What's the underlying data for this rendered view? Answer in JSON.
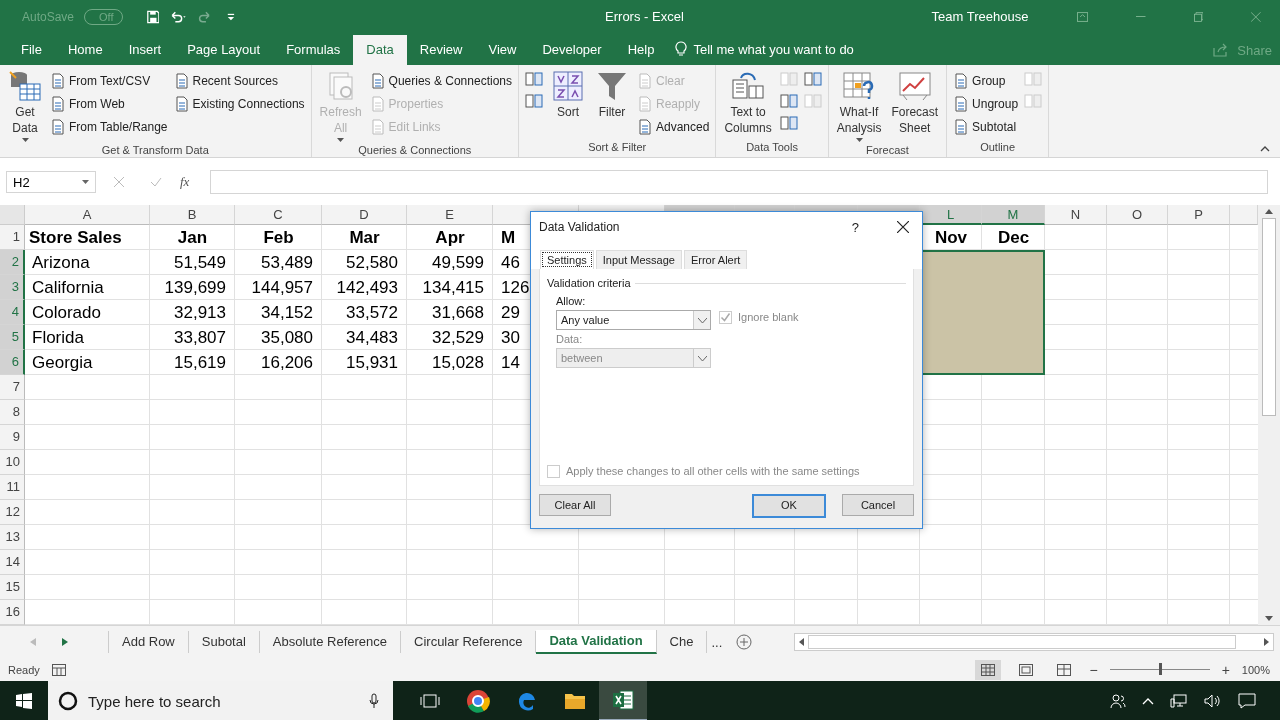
{
  "titlebar": {
    "autosave": "AutoSave",
    "autosave_state": "Off",
    "title": "Errors  -  Excel",
    "user": "Team Treehouse"
  },
  "menu_tabs": [
    {
      "label": "File",
      "selected": false
    },
    {
      "label": "Home",
      "selected": false
    },
    {
      "label": "Insert",
      "selected": false
    },
    {
      "label": "Page Layout",
      "selected": false
    },
    {
      "label": "Formulas",
      "selected": false
    },
    {
      "label": "Data",
      "selected": true
    },
    {
      "label": "Review",
      "selected": false
    },
    {
      "label": "View",
      "selected": false
    },
    {
      "label": "Developer",
      "selected": false
    },
    {
      "label": "Help",
      "selected": false
    }
  ],
  "tell_me": "Tell me what you want to do",
  "share": "Share",
  "ribbon": [
    {
      "label": "Get & Transform Data",
      "columns": [
        {
          "kind": "large",
          "lines": [
            "Get",
            "Data"
          ],
          "caret": true,
          "disabled": false
        },
        {
          "kind": "small",
          "items": [
            {
              "label": "From Text/CSV",
              "disabled": false
            },
            {
              "label": "From Web",
              "disabled": false
            },
            {
              "label": "From Table/Range",
              "disabled": false
            }
          ]
        },
        {
          "kind": "small",
          "items": [
            {
              "label": "Recent Sources",
              "disabled": false
            },
            {
              "label": "Existing Connections",
              "disabled": false
            }
          ]
        }
      ]
    },
    {
      "label": "Queries & Connections",
      "columns": [
        {
          "kind": "large",
          "lines": [
            "Refresh",
            "All"
          ],
          "caret": true,
          "disabled": true
        },
        {
          "kind": "small",
          "items": [
            {
              "label": "Queries & Connections",
              "disabled": false
            },
            {
              "label": "Properties",
              "disabled": true
            },
            {
              "label": "Edit Links",
              "disabled": true
            }
          ]
        }
      ]
    },
    {
      "label": "Sort & Filter",
      "columns": [
        {
          "kind": "icons",
          "items": [
            {
              "disabled": false
            },
            {
              "disabled": false
            }
          ]
        },
        {
          "kind": "large",
          "lines": [
            "Sort"
          ],
          "caret": false,
          "disabled": false
        },
        {
          "kind": "large",
          "lines": [
            "Filter"
          ],
          "caret": false,
          "disabled": false
        },
        {
          "kind": "small",
          "items": [
            {
              "label": "Clear",
              "disabled": true
            },
            {
              "label": "Reapply",
              "disabled": true
            },
            {
              "label": "Advanced",
              "disabled": false
            }
          ]
        }
      ]
    },
    {
      "label": "Data Tools",
      "columns": [
        {
          "kind": "large",
          "lines": [
            "Text to",
            "Columns"
          ],
          "caret": false,
          "disabled": false
        },
        {
          "kind": "icons",
          "items": [
            {
              "disabled": true
            },
            {
              "disabled": false
            },
            {
              "disabled": false
            }
          ]
        },
        {
          "kind": "icons",
          "items": [
            {
              "disabled": false
            },
            {
              "disabled": true
            }
          ]
        }
      ]
    },
    {
      "label": "Forecast",
      "columns": [
        {
          "kind": "large",
          "lines": [
            "What-If",
            "Analysis"
          ],
          "caret": true,
          "disabled": false
        },
        {
          "kind": "large",
          "lines": [
            "Forecast",
            "Sheet"
          ],
          "caret": false,
          "disabled": false
        }
      ]
    },
    {
      "label": "Outline",
      "columns": [
        {
          "kind": "small",
          "items": [
            {
              "label": "Group",
              "disabled": false
            },
            {
              "label": "Ungroup",
              "disabled": false
            },
            {
              "label": "Subtotal",
              "disabled": false
            }
          ]
        },
        {
          "kind": "icons",
          "items": [
            {
              "disabled": true
            },
            {
              "disabled": true
            }
          ]
        }
      ]
    }
  ],
  "formula_bar": {
    "name_box": "H2",
    "fx": "fx"
  },
  "columns": [
    {
      "label": "A",
      "selected": false
    },
    {
      "label": "B",
      "selected": false
    },
    {
      "label": "C",
      "selected": false
    },
    {
      "label": "D",
      "selected": false
    },
    {
      "label": "E",
      "selected": false
    },
    {
      "selected": false
    },
    {
      "selected": false
    },
    {
      "selected": true
    },
    {
      "selected": true
    },
    {
      "selected": true
    },
    {
      "selected": true
    },
    {
      "label": "L",
      "selected": true
    },
    {
      "label": "M",
      "selected": true
    },
    {
      "label": "N",
      "selected": false
    },
    {
      "label": "O",
      "selected": false
    },
    {
      "label": "P",
      "selected": false
    }
  ],
  "row_numbers": [
    {
      "label": "1",
      "selected": false
    },
    {
      "label": "2",
      "selected": true
    },
    {
      "label": "3",
      "selected": true
    },
    {
      "label": "4",
      "selected": true
    },
    {
      "label": "5",
      "selected": true
    },
    {
      "label": "6",
      "selected": true
    },
    {
      "label": "7",
      "selected": false
    },
    {
      "label": "8",
      "selected": false
    },
    {
      "label": "9",
      "selected": false
    },
    {
      "label": "10",
      "selected": false
    },
    {
      "label": "11",
      "selected": false
    },
    {
      "label": "12",
      "selected": false
    },
    {
      "label": "13",
      "selected": false
    },
    {
      "label": "14",
      "selected": false
    },
    {
      "label": "15",
      "selected": false
    },
    {
      "label": "16",
      "selected": false
    }
  ],
  "sheet": {
    "title": "Store Sales",
    "months": [
      "Jan",
      "Feb",
      "Mar",
      "Apr",
      "M"
    ],
    "months_end": [
      "Nov",
      "Dec"
    ],
    "rows": [
      {
        "name": "Arizona",
        "values": [
          "51,549",
          "53,489",
          "52,580",
          "49,599",
          "46"
        ]
      },
      {
        "name": "California",
        "values": [
          "139,699",
          "144,957",
          "142,493",
          "134,415",
          "126"
        ]
      },
      {
        "name": "Colorado",
        "values": [
          "32,913",
          "34,152",
          "33,572",
          "31,668",
          "29"
        ]
      },
      {
        "name": "Florida",
        "values": [
          "33,807",
          "35,080",
          "34,483",
          "32,529",
          "30"
        ]
      },
      {
        "name": "Georgia",
        "values": [
          "15,619",
          "16,206",
          "15,931",
          "15,028",
          "14"
        ]
      }
    ]
  },
  "dialog": {
    "title": "Data Validation",
    "help": "?",
    "tabs": [
      {
        "label": "Settings",
        "selected": true
      },
      {
        "label": "Input Message",
        "selected": false
      },
      {
        "label": "Error Alert",
        "selected": false
      }
    ],
    "section": "Validation criteria",
    "allow_label": "Allow:",
    "allow_value": "Any value",
    "ignore_blank": {
      "label": "Ignore blank",
      "checked": true,
      "disabled": true
    },
    "data_label": "Data:",
    "data_value": "between",
    "data_disabled": true,
    "apply": {
      "label": "Apply these changes to all other cells with the same settings",
      "checked": false,
      "disabled": true
    },
    "buttons": [
      {
        "label": "Clear All",
        "kind": "left"
      },
      {
        "label": "OK",
        "kind": "default"
      },
      {
        "label": "Cancel",
        "kind": "normal"
      }
    ]
  },
  "sheet_tabs": [
    {
      "label": "Add Row",
      "selected": false
    },
    {
      "label": "Subotal",
      "selected": false
    },
    {
      "label": "Absolute Reference",
      "selected": false
    },
    {
      "label": "Circular Reference",
      "selected": false
    },
    {
      "label": "Data Validation",
      "selected": true
    },
    {
      "label": "Che",
      "selected": false
    }
  ],
  "sheet_tabs_more": "...",
  "status": {
    "ready": "Ready",
    "zoom": "100%",
    "zoom_out": "−",
    "zoom_in": "+",
    "zoom_slider": {
      "level": 0.5
    }
  },
  "taskbar": {
    "search_placeholder": "Type here to search"
  }
}
